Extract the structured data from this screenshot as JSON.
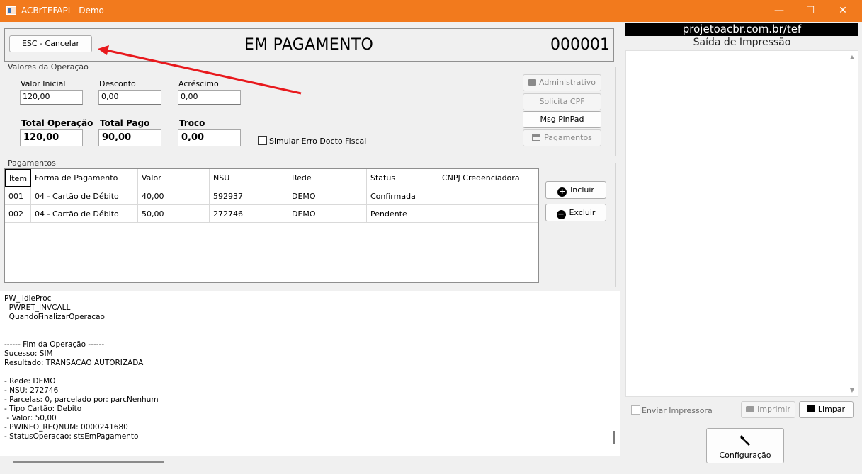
{
  "window": {
    "title": "ACBrTEFAPI - Demo",
    "minimize_glyph": "—",
    "maximize_glyph": "☐",
    "close_glyph": "✕"
  },
  "header": {
    "cancel_label": "ESC - Cancelar",
    "status_title": "EM PAGAMENTO",
    "operation_number": "000001"
  },
  "valores": {
    "group_title": "Valores da Operação",
    "valor_inicial_label": "Valor Inicial",
    "valor_inicial": "120,00",
    "desconto_label": "Desconto",
    "desconto": "0,00",
    "acrescimo_label": "Acréscimo",
    "acrescimo": "0,00",
    "total_operacao_label": "Total Operação",
    "total_operacao": "120,00",
    "total_pago_label": "Total Pago",
    "total_pago": "90,00",
    "troco_label": "Troco",
    "troco": "0,00",
    "simular_label": "Simular Erro Docto Fiscal",
    "btn_administrativo": "Administrativo",
    "btn_solicita_cpf": "Solicita CPF",
    "btn_msg_pinpad": "Msg PinPad",
    "btn_pagamentos": "Pagamentos"
  },
  "pagamentos": {
    "group_title": "Pagamentos",
    "columns": [
      "Item",
      "Forma de Pagamento",
      "Valor",
      "NSU",
      "Rede",
      "Status",
      "CNPJ Credenciadora"
    ],
    "rows": [
      [
        "001",
        "04 - Cartão de Débito",
        "40,00",
        "592937",
        "DEMO",
        "Confirmada",
        ""
      ],
      [
        "002",
        "04 - Cartão de Débito",
        "50,00",
        "272746",
        "DEMO",
        "Pendente",
        ""
      ]
    ],
    "btn_incluir": "Incluir",
    "btn_excluir": "Excluir"
  },
  "log": {
    "text": "PW_iIdleProc\n  PWRET_INVCALL\n  QuandoFinalizarOperacao\n\n\n------ Fim da Operação ------\nSucesso: SIM\nResultado: TRANSACAO AUTORIZADA\n\n- Rede: DEMO\n- NSU: 272746\n- Parcelas: 0, parcelado por: parcNenhum\n- Tipo Cartão: Debito\n - Valor: 50,00\n- PWINFO_REQNUM: 0000241680\n- StatusOperacao: stsEmPagamento"
  },
  "impressao": {
    "banner": "projetoacbr.com.br/tef",
    "title": "Saída de Impressão",
    "enviar_label": "Enviar Impressora",
    "btn_imprimir": "Imprimir",
    "btn_limpar": "Limpar",
    "btn_configuracao": "Configuração"
  },
  "colors": {
    "titlebar": "#f27a1d",
    "annotation_arrow": "#e8191d"
  }
}
